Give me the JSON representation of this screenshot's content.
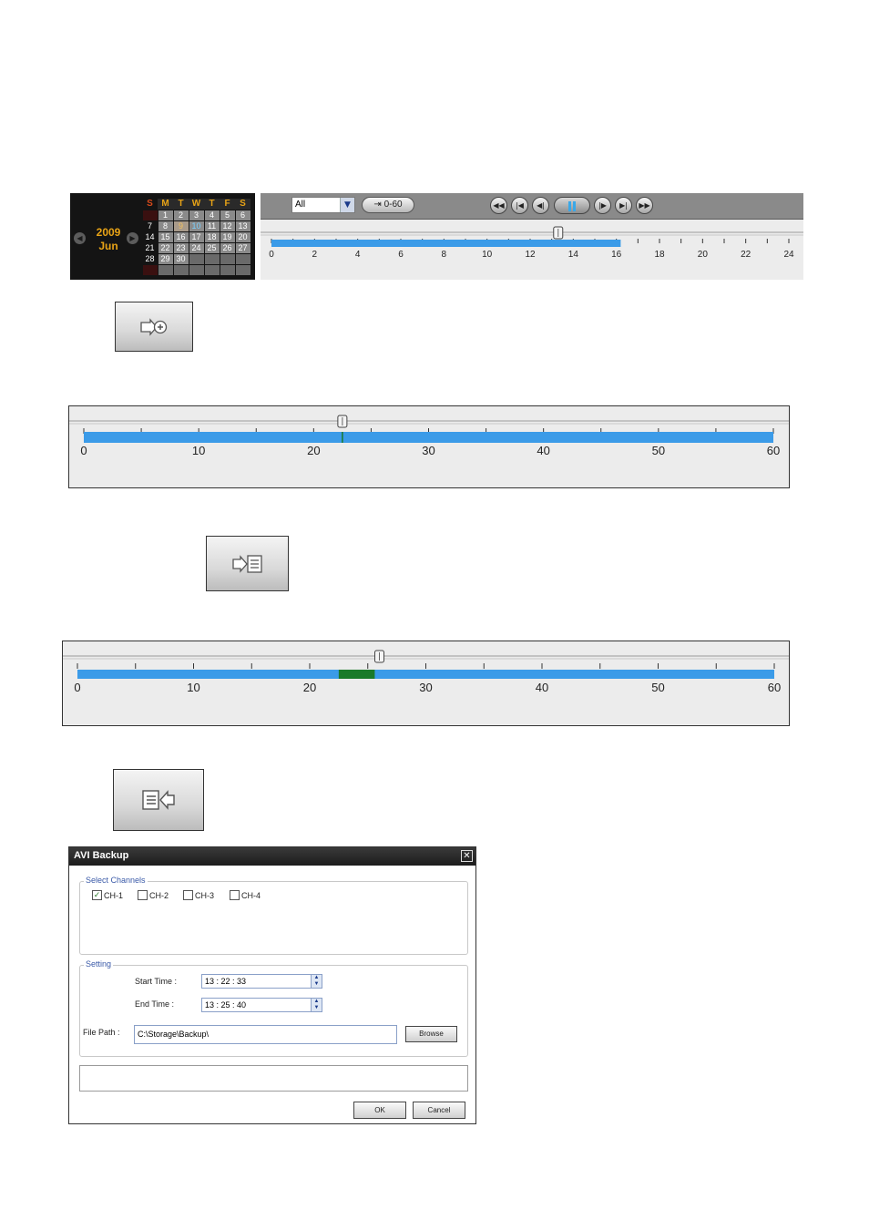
{
  "calendar": {
    "year": "2009",
    "month": "Jun",
    "weekdays": [
      "S",
      "M",
      "T",
      "W",
      "T",
      "F",
      "S"
    ],
    "weeks": [
      [
        "",
        "1",
        "2",
        "3",
        "4",
        "5",
        "6"
      ],
      [
        "7",
        "8",
        "9",
        "10",
        "11",
        "12",
        "13"
      ],
      [
        "14",
        "15",
        "16",
        "17",
        "18",
        "19",
        "20"
      ],
      [
        "21",
        "22",
        "23",
        "24",
        "25",
        "26",
        "27"
      ],
      [
        "28",
        "29",
        "30",
        "",
        "",
        "",
        ""
      ],
      [
        "",
        "",
        "",
        "",
        "",
        "",
        ""
      ]
    ],
    "selected_day": "10",
    "recorded_day": "9"
  },
  "playback": {
    "channel_select": "All",
    "range_button_label": "0-60",
    "buttons": [
      "fast-rewind",
      "previous",
      "step-back",
      "pause",
      "step-forward",
      "next",
      "fast-forward"
    ],
    "timeline": {
      "labels": [
        "0",
        "2",
        "4",
        "6",
        "8",
        "10",
        "12",
        "14",
        "16",
        "18",
        "20",
        "22",
        "24"
      ],
      "max": 24,
      "recorded_until": 16.2,
      "position": 13.3
    }
  },
  "buttons": {
    "mark_in_icon": "mark-in-icon",
    "mark_out_icon": "mark-out-icon",
    "backup_icon": "backup-icon"
  },
  "timeline_a": {
    "labels": [
      "0",
      "10",
      "20",
      "30",
      "40",
      "50",
      "60"
    ],
    "max": 60,
    "position": 22.5,
    "marker": 22.5
  },
  "timeline_b": {
    "labels": [
      "0",
      "10",
      "20",
      "30",
      "40",
      "50",
      "60"
    ],
    "max": 60,
    "position": 26,
    "selection": [
      22.5,
      25.6
    ]
  },
  "dialog": {
    "title": "AVI Backup",
    "channels_group_label": "Select Channels",
    "channels": [
      {
        "label": "CH-1",
        "checked": true
      },
      {
        "label": "CH-2",
        "checked": false
      },
      {
        "label": "CH-3",
        "checked": false
      },
      {
        "label": "CH-4",
        "checked": false
      }
    ],
    "setting_group_label": "Setting",
    "start_time_label": "Start Time :",
    "start_time_value": "13 : 22 : 33",
    "end_time_label": "End Time :",
    "end_time_value": "13 : 25 : 40",
    "file_path_label": "File Path :",
    "file_path_value": "C:\\Storage\\Backup\\",
    "browse_label": "Browse",
    "status_text": "",
    "ok_label": "OK",
    "cancel_label": "Cancel"
  },
  "colors": {
    "timeline_bar": "#3b9be8",
    "selection": "#1a7a2a",
    "calendar_accent": "#e8a316"
  }
}
